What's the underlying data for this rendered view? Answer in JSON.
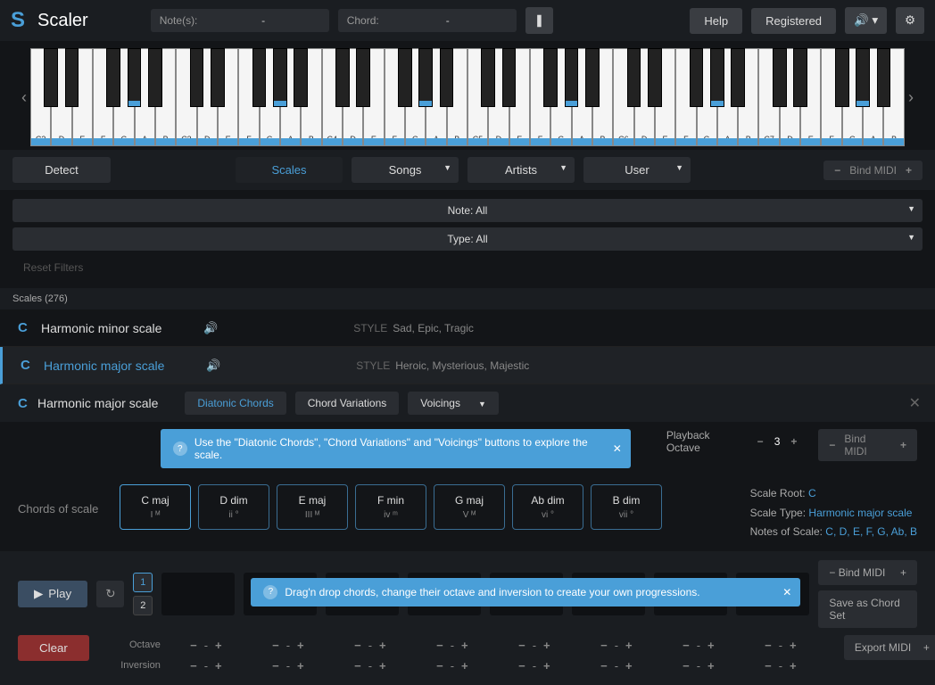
{
  "header": {
    "app": "Scaler",
    "notes_label": "Note(s):",
    "notes_val": "-",
    "chord_label": "Chord:",
    "chord_val": "-",
    "help": "Help",
    "registered": "Registered"
  },
  "tabs": {
    "detect": "Detect",
    "scales": "Scales",
    "songs": "Songs",
    "artists": "Artists",
    "user": "User",
    "bind_midi": "Bind MIDI"
  },
  "filters": {
    "note": "Note: All",
    "type": "Type: All",
    "reset": "Reset Filters"
  },
  "scales_count": "Scales (276)",
  "scale_list": [
    {
      "root": "C",
      "name": "Harmonic minor scale",
      "style": "Sad, Epic, Tragic"
    },
    {
      "root": "C",
      "name": "Harmonic major scale",
      "style": "Heroic, Mysterious, Majestic"
    }
  ],
  "detail": {
    "root": "C",
    "title": "Harmonic major scale",
    "diatonic": "Diatonic Chords",
    "variations": "Chord Variations",
    "voicings": "Voicings",
    "tip1": "Use the \"Diatonic Chords\", \"Chord Variations\" and \"Voicings\" buttons to explore the scale.",
    "playback_label": "Playback Octave",
    "playback_val": "3",
    "bind_midi": "Bind MIDI",
    "chords_label": "Chords of scale",
    "chords": [
      {
        "name": "C maj",
        "roman": "I ᴹ"
      },
      {
        "name": "D dim",
        "roman": "ii °"
      },
      {
        "name": "E maj",
        "roman": "III ᴹ"
      },
      {
        "name": "F min",
        "roman": "iv ᵐ"
      },
      {
        "name": "G maj",
        "roman": "V ᴹ"
      },
      {
        "name": "Ab dim",
        "roman": "vi °"
      },
      {
        "name": "B dim",
        "roman": "vii °"
      }
    ],
    "scale_root_label": "Scale Root:",
    "scale_root": "C",
    "scale_type_label": "Scale Type:",
    "scale_type": "Harmonic major scale",
    "notes_label": "Notes of Scale:",
    "notes": "C, D, E, F, G, Ab, B"
  },
  "prog": {
    "play": "Play",
    "tip2": "Drag'n drop chords, change their octave and inversion to create your own progressions.",
    "bind_midi": "Bind MIDI",
    "save": "Save as Chord Set",
    "export": "Export MIDI",
    "octave": "Octave",
    "inversion": "Inversion",
    "clear": "Clear",
    "style_word": "STYLE"
  },
  "piano": {
    "octaves": [
      "C2",
      "C3",
      "C4",
      "C5",
      "C6",
      "C7"
    ],
    "white_notes": [
      "C",
      "D",
      "E",
      "F",
      "G",
      "A",
      "B"
    ]
  }
}
